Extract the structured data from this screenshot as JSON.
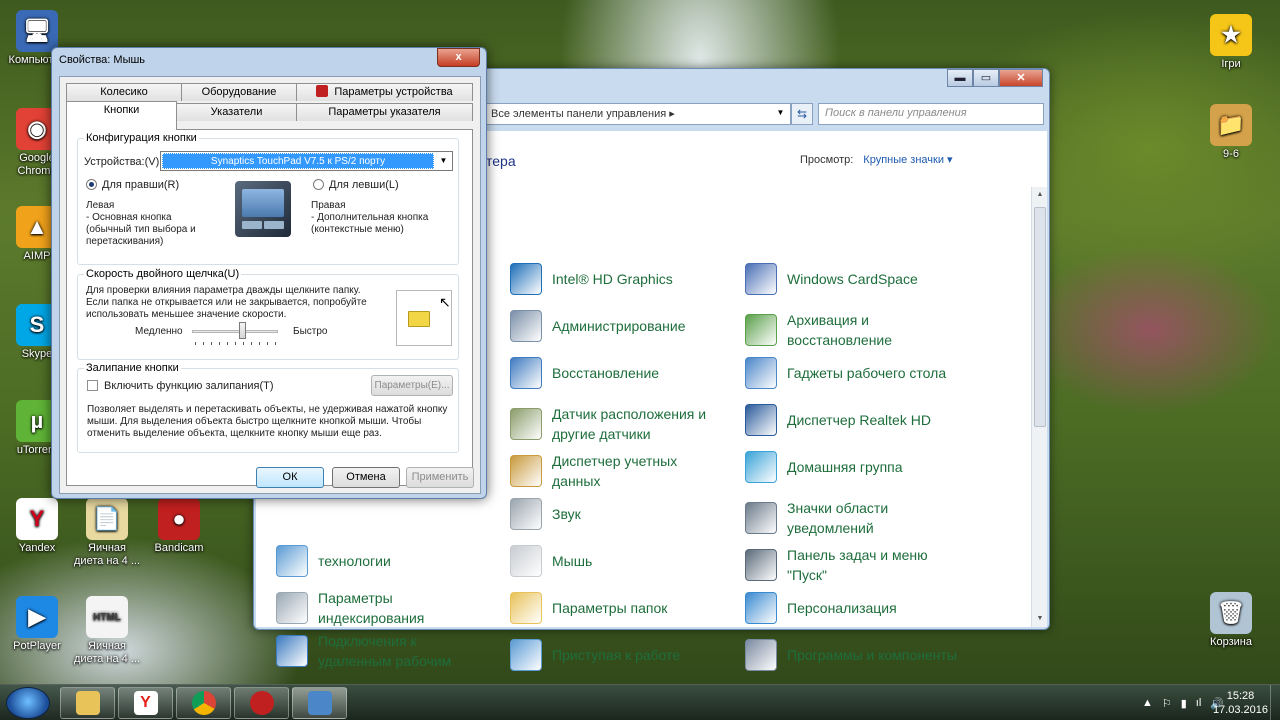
{
  "desktop": {
    "icons": [
      {
        "label": "Компьютер",
        "color": "#3a6ab5",
        "glyph": "🖥"
      },
      {
        "label": "Google Chrome",
        "color": "#e24135",
        "glyph": "◉"
      },
      {
        "label": "AIMP",
        "color": "#f0a21a",
        "glyph": "▲"
      },
      {
        "label": "Skype",
        "color": "#00a7e7",
        "glyph": "S"
      },
      {
        "label": "uTorrent",
        "color": "#5fb336",
        "glyph": "µ"
      },
      {
        "label": "Yandex",
        "color": "#ffffff",
        "glyph": "Y"
      },
      {
        "label": "Яичная диета на 4 ...",
        "color": "#e8d9a0",
        "glyph": "📄"
      },
      {
        "label": "Bandicam",
        "color": "#c0201f",
        "glyph": "●"
      },
      {
        "label": "PotPlayer",
        "color": "#1e88e5",
        "glyph": "▶"
      },
      {
        "label": "Яичная диета на 4 ...",
        "color": "#f4f4f4",
        "glyph": "HTML"
      },
      {
        "label": "Ігри",
        "color": "#f5c518",
        "glyph": "★"
      },
      {
        "label": "9-6",
        "color": "#d4a24a",
        "glyph": "📁"
      },
      {
        "label": "Корзина",
        "color": "#b0c4d4",
        "glyph": "🗑"
      }
    ]
  },
  "control_panel": {
    "address": "Все элементы панели управления  ▸",
    "search_placeholder": "Поиск в панели управления",
    "heading": "тера",
    "view_label": "Просмотр:",
    "view_value": "Крупные значки ▾",
    "items_col1": [
      {
        "label": "Intel® HD Graphics",
        "color": "#1e6fb8"
      },
      {
        "label": "Администрирование",
        "color": "#7a8fa8"
      },
      {
        "label": "Восстановление",
        "color": "#3f7bc0"
      },
      {
        "label": "Датчик расположения и другие датчики",
        "color": "#8a9c6a"
      },
      {
        "label": "Диспетчер учетных данных",
        "color": "#c89a3c"
      },
      {
        "label": "Звук",
        "color": "#9aa4ad"
      },
      {
        "label": "Мышь",
        "color": "#c8ccd1"
      },
      {
        "label": "Параметры папок",
        "color": "#e8c35a"
      },
      {
        "label": "Приступая к работе",
        "color": "#5a9bd4"
      }
    ],
    "items_col2": [
      {
        "label": "Windows CardSpace",
        "color": "#4a6fb5"
      },
      {
        "label": "Архивация и восстановление",
        "color": "#5aa04a"
      },
      {
        "label": "Гаджеты рабочего стола",
        "color": "#4a86c8"
      },
      {
        "label": "Диспетчер Realtek HD",
        "color": "#2a5a9a"
      },
      {
        "label": "Домашняя группа",
        "color": "#3aa3d8"
      },
      {
        "label": "Значки области уведомлений",
        "color": "#6a7a8a"
      },
      {
        "label": "Панель задач и меню \"Пуск\"",
        "color": "#5a6a7a"
      },
      {
        "label": "Персонализация",
        "color": "#3a8ad0"
      },
      {
        "label": "Программы и компоненты",
        "color": "#7a8aa0"
      }
    ],
    "items_left": [
      {
        "label": "технологии",
        "color": "#5a9bd4"
      },
      {
        "label": "Параметры индексирования",
        "color": "#9aa8b4"
      },
      {
        "label": "Подключения к удаленным рабочим",
        "color": "#3a7ac0"
      }
    ]
  },
  "mouse_dialog": {
    "title": "Свойства: Мышь",
    "close": "x",
    "tabs_row1": [
      "Колесико",
      "Оборудование",
      "Параметры устройства"
    ],
    "tabs_row2": [
      "Кнопки",
      "Указатели",
      "Параметры указателя"
    ],
    "button_config": {
      "caption": "Конфигурация кнопки",
      "device_label": "Устройства:(V)",
      "device_value": "Synaptics TouchPad V7.5 к PS/2 порту",
      "right_handed": "Для правши(R)",
      "left_handed": "Для левши(L)",
      "left_title": "Левая",
      "left_desc": "- Основная кнопка (обычный тип выбора и перетаскивания)",
      "right_title": "Правая",
      "right_desc": "- Дополнительная кнопка (контекстные меню)"
    },
    "double_click": {
      "caption": "Скорость двойного щелчка(U)",
      "desc": "Для проверки влияния параметра дважды щелкните папку. Если папка не открывается или не закрывается, попробуйте использовать меньшее значение скорости.",
      "slow": "Медленно",
      "fast": "Быстро",
      "speed_fraction": 0.6
    },
    "click_lock": {
      "caption": "Залипание кнопки",
      "checkbox": "Включить функцию залипания(T)",
      "params_button": "Параметры(E)...",
      "desc": "Позволяет выделять и перетаскивать объекты, не удерживая нажатой кнопку мыши. Для выделения объекта быстро щелкните кнопкой мыши. Чтобы отменить выделение объекта, щелкните кнопку мыши еще раз."
    },
    "buttons": {
      "ok": "ОК",
      "cancel": "Отмена",
      "apply": "Применить"
    }
  },
  "taskbar": {
    "time": "15:28",
    "date": "17.03.2016",
    "tray_icons": [
      "▲",
      "⚐",
      "▮",
      "ıl",
      "🔊"
    ]
  }
}
